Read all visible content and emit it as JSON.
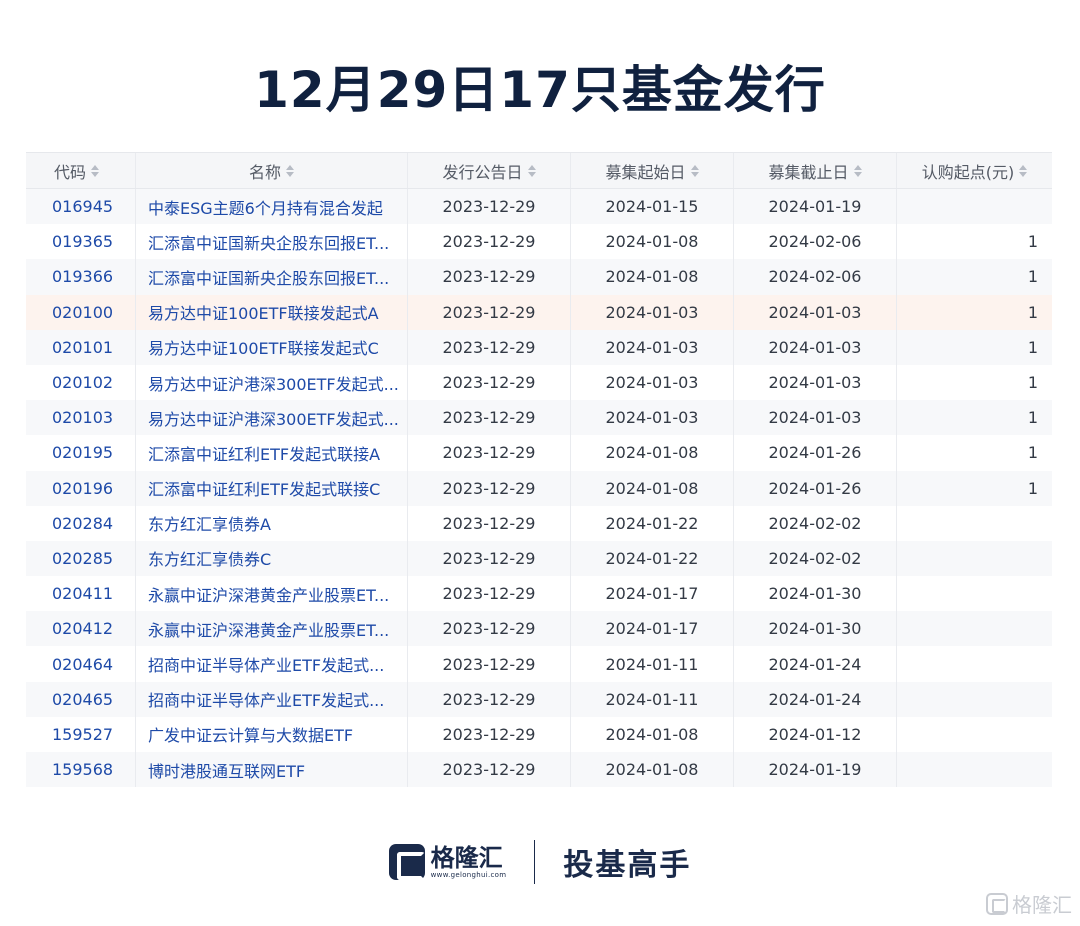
{
  "title": "12月29日17只基金发行",
  "table": {
    "columns": [
      "代码",
      "名称",
      "发行公告日",
      "募集起始日",
      "募集截止日",
      "认购起点(元)"
    ],
    "rows": [
      {
        "code": "016945",
        "name": "中泰ESG主题6个月持有混合发起",
        "announce": "2023-12-29",
        "start": "2024-01-15",
        "end": "2024-01-19",
        "min": ""
      },
      {
        "code": "019365",
        "name": "汇添富中证国新央企股东回报ET...",
        "announce": "2023-12-29",
        "start": "2024-01-08",
        "end": "2024-02-06",
        "min": "1"
      },
      {
        "code": "019366",
        "name": "汇添富中证国新央企股东回报ET...",
        "announce": "2023-12-29",
        "start": "2024-01-08",
        "end": "2024-02-06",
        "min": "1"
      },
      {
        "code": "020100",
        "name": "易方达中证100ETF联接发起式A",
        "announce": "2023-12-29",
        "start": "2024-01-03",
        "end": "2024-01-03",
        "min": "1"
      },
      {
        "code": "020101",
        "name": "易方达中证100ETF联接发起式C",
        "announce": "2023-12-29",
        "start": "2024-01-03",
        "end": "2024-01-03",
        "min": "1"
      },
      {
        "code": "020102",
        "name": "易方达中证沪港深300ETF发起式...",
        "announce": "2023-12-29",
        "start": "2024-01-03",
        "end": "2024-01-03",
        "min": "1"
      },
      {
        "code": "020103",
        "name": "易方达中证沪港深300ETF发起式...",
        "announce": "2023-12-29",
        "start": "2024-01-03",
        "end": "2024-01-03",
        "min": "1"
      },
      {
        "code": "020195",
        "name": "汇添富中证红利ETF发起式联接A",
        "announce": "2023-12-29",
        "start": "2024-01-08",
        "end": "2024-01-26",
        "min": "1"
      },
      {
        "code": "020196",
        "name": "汇添富中证红利ETF发起式联接C",
        "announce": "2023-12-29",
        "start": "2024-01-08",
        "end": "2024-01-26",
        "min": "1"
      },
      {
        "code": "020284",
        "name": "东方红汇享债券A",
        "announce": "2023-12-29",
        "start": "2024-01-22",
        "end": "2024-02-02",
        "min": ""
      },
      {
        "code": "020285",
        "name": "东方红汇享债券C",
        "announce": "2023-12-29",
        "start": "2024-01-22",
        "end": "2024-02-02",
        "min": ""
      },
      {
        "code": "020411",
        "name": "永赢中证沪深港黄金产业股票ET...",
        "announce": "2023-12-29",
        "start": "2024-01-17",
        "end": "2024-01-30",
        "min": ""
      },
      {
        "code": "020412",
        "name": "永赢中证沪深港黄金产业股票ET...",
        "announce": "2023-12-29",
        "start": "2024-01-17",
        "end": "2024-01-30",
        "min": ""
      },
      {
        "code": "020464",
        "name": "招商中证半导体产业ETF发起式...",
        "announce": "2023-12-29",
        "start": "2024-01-11",
        "end": "2024-01-24",
        "min": ""
      },
      {
        "code": "020465",
        "name": "招商中证半导体产业ETF发起式...",
        "announce": "2023-12-29",
        "start": "2024-01-11",
        "end": "2024-01-24",
        "min": ""
      },
      {
        "code": "159527",
        "name": "广发中证云计算与大数据ETF",
        "announce": "2023-12-29",
        "start": "2024-01-08",
        "end": "2024-01-12",
        "min": ""
      },
      {
        "code": "159568",
        "name": "博时港股通互联网ETF",
        "announce": "2023-12-29",
        "start": "2024-01-08",
        "end": "2024-01-19",
        "min": ""
      }
    ]
  },
  "footer": {
    "brand_name": "格隆汇",
    "brand_url": "www.gelonghui.com",
    "slogan": "投基高手"
  },
  "watermark": "格隆汇",
  "colors": {
    "title": "#10213f",
    "link": "#1e4aa8",
    "header_bg": "#f5f6f8",
    "highlight_row": "#fdf3ee",
    "brand": "#1a2a4a"
  }
}
